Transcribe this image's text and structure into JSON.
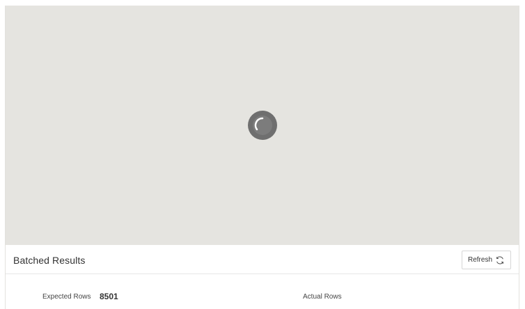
{
  "loading": {
    "spinner_icon": "loading-spinner-icon",
    "spinner_color": "#6f6f6f",
    "background_color": "#e5e4e0"
  },
  "panel": {
    "title": "Batched Results",
    "refresh_label": "Refresh",
    "refresh_icon": "refresh-icon"
  },
  "stats": {
    "expected_rows_label": "Expected Rows",
    "expected_rows_value": "8501",
    "actual_rows_label": "Actual Rows",
    "actual_rows_value": ""
  }
}
